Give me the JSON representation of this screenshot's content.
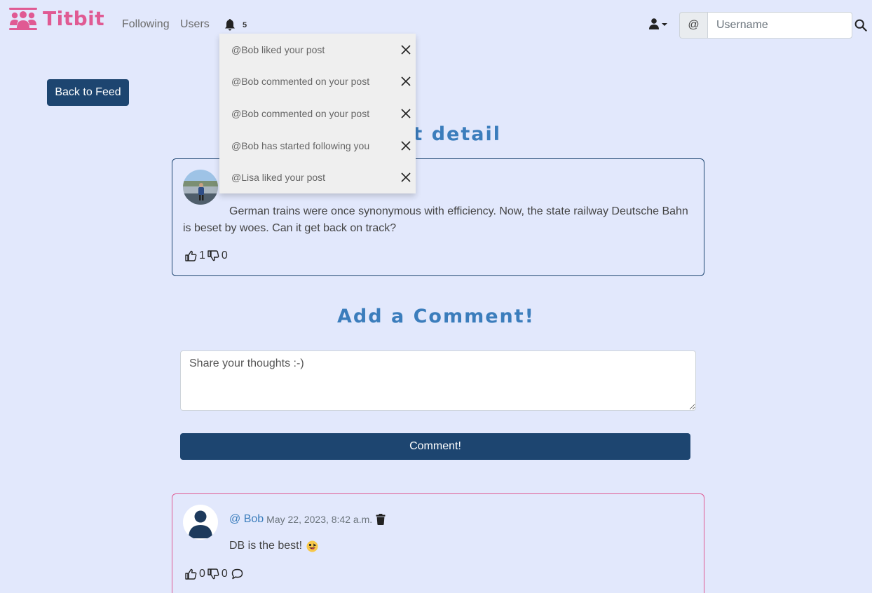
{
  "brand": {
    "name": "Titbit",
    "color": "#e05a93"
  },
  "nav": {
    "following": "Following",
    "users": "Users",
    "notification_count": "5"
  },
  "search": {
    "prefix": "@",
    "placeholder": "Username"
  },
  "notifications": [
    {
      "text": "@Bob liked your post"
    },
    {
      "text": "@Bob commented on your post"
    },
    {
      "text": "@Bob commented on your post"
    },
    {
      "text": "@Bob has started following you"
    },
    {
      "text": "@Lisa liked your post"
    }
  ],
  "back_button": "Back to Feed",
  "post_heading": "Post detail",
  "post": {
    "content": "German trains were once synonymous with efficiency. Now, the state railway Deutsche Bahn is beset by woes. Can it get back on track?",
    "likes": "1",
    "dislikes": "0"
  },
  "comment_form": {
    "heading": "Add a Comment!",
    "placeholder": "Share your thoughts :-)",
    "submit": "Comment!"
  },
  "comments": [
    {
      "user": "@ Bob",
      "date": "May 22, 2023, 8:42 a.m.",
      "text": "DB is the best!",
      "likes": "0",
      "dislikes": "0"
    }
  ],
  "colors": {
    "background": "#e2e8fc",
    "primary": "#1d4570",
    "heading": "#3b7dbc",
    "accent": "#e05a93"
  },
  "icons": [
    "users-icon",
    "bell-icon",
    "user-icon",
    "search-icon",
    "close-icon",
    "thumbs-up-icon",
    "thumbs-down-icon",
    "trash-icon",
    "speech-bubble-icon",
    "emoji-icon"
  ]
}
